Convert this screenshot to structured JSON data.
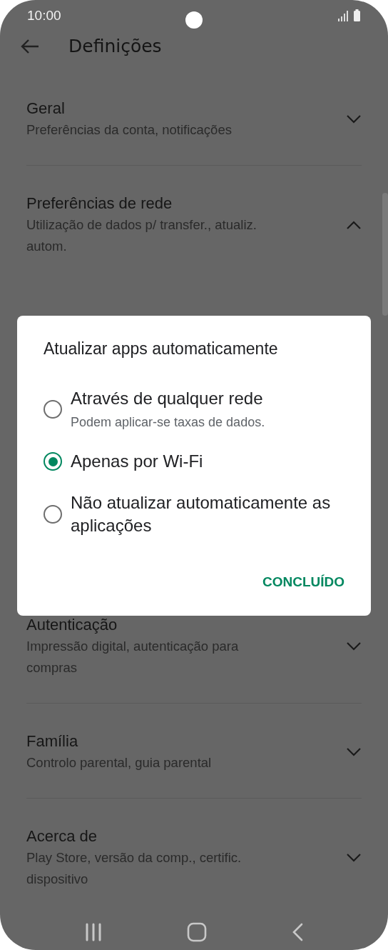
{
  "status_bar": {
    "time": "10:00"
  },
  "toolbar": {
    "title": "Definições"
  },
  "settings": [
    {
      "title": "Geral",
      "subtitle_lines": [
        "Preferências da conta, notificações"
      ],
      "expanded": false
    },
    {
      "title": "Preferências de rede",
      "subtitle_lines": [
        "Utilização de dados p/ transfer., atualiz.",
        "autom."
      ],
      "expanded": true
    },
    {
      "title": "Autenticação",
      "subtitle_lines": [
        "Impressão digital, autenticação para",
        "compras"
      ],
      "expanded": false
    },
    {
      "title": "Família",
      "subtitle_lines": [
        "Controlo parental, guia parental"
      ],
      "expanded": false
    },
    {
      "title": "Acerca de",
      "subtitle_lines": [
        "Play Store, versão da comp., certific.",
        "dispositivo"
      ],
      "expanded": false
    }
  ],
  "dialog": {
    "title": "Atualizar apps automaticamente",
    "options": [
      {
        "label": "Através de qualquer rede",
        "description": "Podem aplicar-se taxas de dados.",
        "selected": false
      },
      {
        "label": "Apenas por Wi-Fi",
        "selected": true
      },
      {
        "label": "Não atualizar automaticamente as aplicações",
        "selected": false
      }
    ],
    "button": "CONCLUÍDO"
  }
}
